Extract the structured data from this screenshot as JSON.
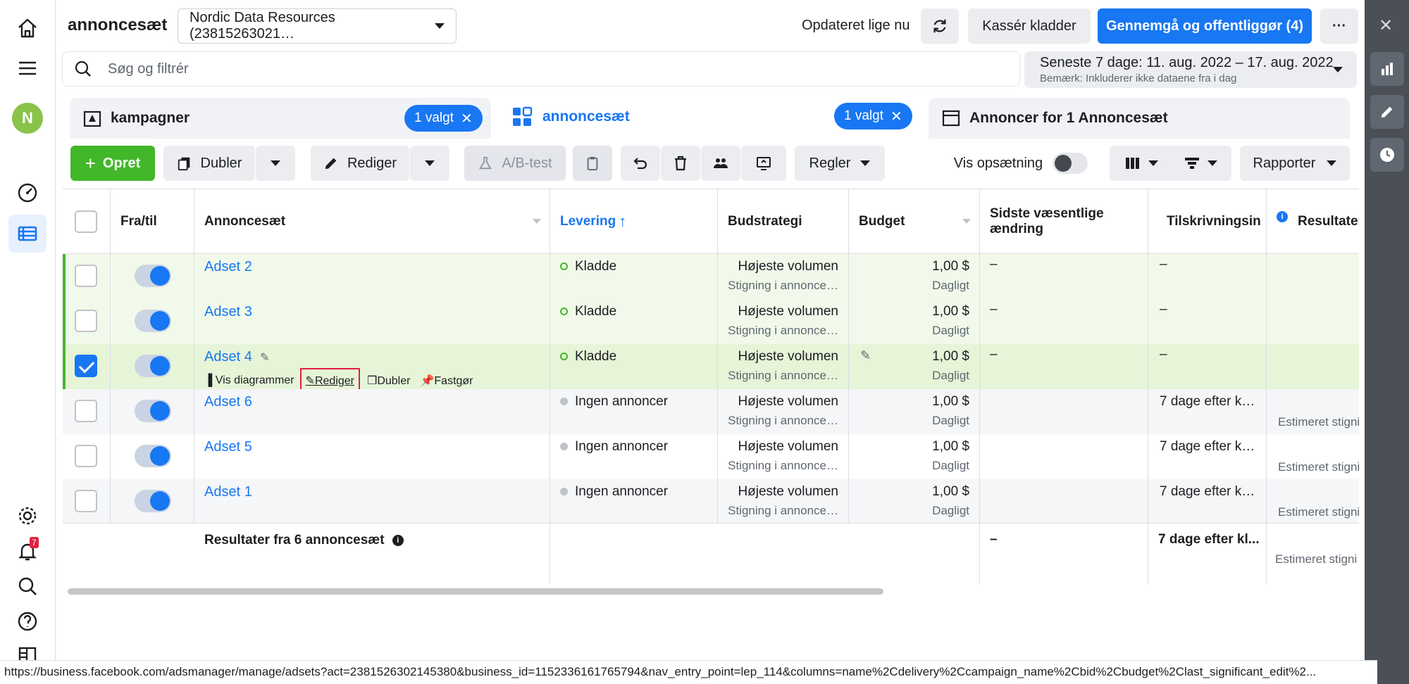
{
  "header": {
    "title": "annoncesæt",
    "account": "Nordic Data Resources (23815263021…",
    "updated": "Opdateret lige nu",
    "discard": "Kassér kladder",
    "publish": "Gennemgå og offentliggør (4)",
    "more": "···"
  },
  "search": {
    "placeholder": "Søg og filtrér"
  },
  "daterange": {
    "line1": "Seneste 7 dage: 11. aug. 2022 – 17. aug. 2022",
    "line2": "Bemærk: Inkluderer ikke dataene fra i dag"
  },
  "tabs": [
    {
      "label": "kampagner",
      "pill": "1 valgt"
    },
    {
      "label": "annoncesæt",
      "pill": "1 valgt"
    },
    {
      "label": "Annoncer for 1 Annoncesæt"
    }
  ],
  "toolbar": {
    "create": "Opret",
    "duplicate": "Dubler",
    "edit": "Rediger",
    "abtest": "A/B-test",
    "rules": "Regler",
    "show_setup": "Vis opsætning",
    "reports": "Rapporter"
  },
  "columns": {
    "onoff": "Fra/til",
    "name": "Annoncesæt",
    "delivery": "Levering",
    "delivery_arrow": "↑",
    "bid": "Budstrategi",
    "budget": "Budget",
    "last_edit": "Sidste væsentlige ændring",
    "attribution": "Tilskrivningsin",
    "results": "Resultater"
  },
  "rows": [
    {
      "name": "Adset 2",
      "delivery": "Kladde",
      "bid": "Højeste volumen",
      "bid_sub": "Stigning i annonce…",
      "budget": "1,00 $",
      "budget_sub": "Dagligt",
      "last_edit": "–",
      "attribution": "–",
      "results": ""
    },
    {
      "name": "Adset 3",
      "delivery": "Kladde",
      "bid": "Højeste volumen",
      "bid_sub": "Stigning i annonce…",
      "budget": "1,00 $",
      "budget_sub": "Dagligt",
      "last_edit": "–",
      "attribution": "–",
      "results": ""
    },
    {
      "name": "Adset 4",
      "delivery": "Kladde",
      "bid": "Højeste volumen",
      "bid_sub": "Stigning i annonce…",
      "budget": "1,00 $",
      "budget_sub": "Dagligt",
      "last_edit": "–",
      "attribution": "–",
      "results": ""
    },
    {
      "name": "Adset 6",
      "delivery": "Ingen annoncer",
      "bid": "Højeste volumen",
      "bid_sub": "Stigning i annonce…",
      "budget": "1,00 $",
      "budget_sub": "Dagligt",
      "last_edit": "",
      "attribution": "7 dage efter k…",
      "results": "Estimeret stigni"
    },
    {
      "name": "Adset 5",
      "delivery": "Ingen annoncer",
      "bid": "Højeste volumen",
      "bid_sub": "Stigning i annonce…",
      "budget": "1,00 $",
      "budget_sub": "Dagligt",
      "last_edit": "",
      "attribution": "7 dage efter k…",
      "results": "Estimeret stigni"
    },
    {
      "name": "Adset 1",
      "delivery": "Ingen annoncer",
      "bid": "Højeste volumen",
      "bid_sub": "Stigning i annonce…",
      "budget": "1,00 $",
      "budget_sub": "Dagligt",
      "last_edit": "",
      "attribution": "7 dage efter k…",
      "results": "Estimeret stigni"
    }
  ],
  "row_actions": {
    "charts": "Vis diagrammer",
    "edit": "Rediger",
    "duplicate": "Dubler",
    "pin": "Fastgør"
  },
  "summary": {
    "label": "Resultater fra 6 annoncesæt",
    "last_edit": "–",
    "attribution": "7 dage efter kl...",
    "results": "Estimeret stigni"
  },
  "nav": {
    "avatar": "N",
    "notifications": "7"
  },
  "statusbar": {
    "url": "https://business.facebook.com/adsmanager/manage/adsets?act=2381526302145380&business_id=1152336161765794&nav_entry_point=lep_114&columns=name%2Cdelivery%2Ccampaign_name%2Cbid%2Cbudget%2Clast_significant_edit%2..."
  },
  "colors": {
    "accent": "#1877f2",
    "create": "#42b72a",
    "highlight": "#e41e3f"
  }
}
